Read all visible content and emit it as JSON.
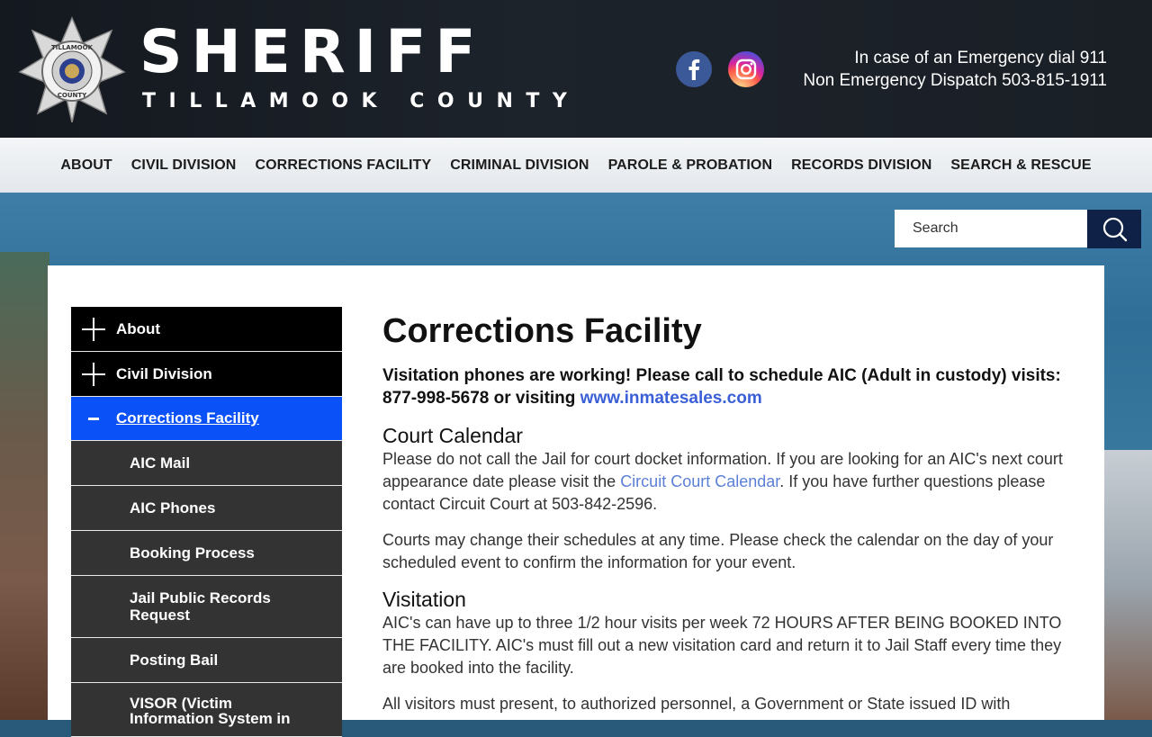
{
  "header": {
    "badge_top": "TILLAMOOK",
    "badge_bottom": "COUNTY",
    "title": "SHERIFF",
    "subtitle": "TILLAMOOK COUNTY",
    "emergency_line1": "In case of an Emergency dial 911",
    "emergency_line2": "Non Emergency Dispatch 503-815-1911",
    "social": [
      "facebook-icon",
      "instagram-icon"
    ]
  },
  "nav": {
    "items": [
      "ABOUT",
      "CIVIL DIVISION",
      "CORRECTIONS FACILITY",
      "CRIMINAL DIVISION",
      "PAROLE & PROBATION",
      "RECORDS DIVISION",
      "SEARCH & RESCUE"
    ]
  },
  "search": {
    "placeholder": "Search"
  },
  "sidebar": {
    "top": [
      {
        "label": "About"
      },
      {
        "label": "Civil Division"
      }
    ],
    "active": {
      "label": "Corrections Facility"
    },
    "sub": [
      {
        "label": "AIC Mail"
      },
      {
        "label": "AIC Phones"
      },
      {
        "label": "Booking Process"
      },
      {
        "label": "Jail Public Records Request"
      },
      {
        "label": "Posting Bail"
      },
      {
        "label": "VISOR (Victim Information System in"
      }
    ]
  },
  "main": {
    "title": "Corrections Facility",
    "notice_text": "Visitation phones are working! Please call to schedule AIC (Adult in custody) visits: 877-998-5678 or visiting ",
    "notice_link": "www.inmatesales.com",
    "court": {
      "heading": "Court Calendar",
      "p1_before": "Please do not call the Jail for court docket information.  If you are looking for an AIC's next court appearance date please visit the ",
      "p1_link": "Circuit Court Calendar",
      "p1_after": ".  If you have further questions please contact Circuit Court at 503-842-2596.",
      "p2": "Courts may change their schedules at any time. Please check the calendar on the day of your scheduled event to confirm the information for your event."
    },
    "visitation": {
      "heading": "Visitation",
      "p1": "AIC's can have up to three 1/2 hour visits per week 72 HOURS AFTER BEING BOOKED INTO THE FACILITY.  AIC's must fill out a new visitation card and return it to Jail Staff every time they are booked into the facility.",
      "p2": "All visitors must present, to authorized personnel, a Government or State issued ID with"
    }
  },
  "colors": {
    "header_bg": "#1a1f26",
    "active_sidebar": "#0a51f7",
    "sub_sidebar": "#333333",
    "search_button": "#0f2147",
    "link": "#3a5fd6"
  }
}
